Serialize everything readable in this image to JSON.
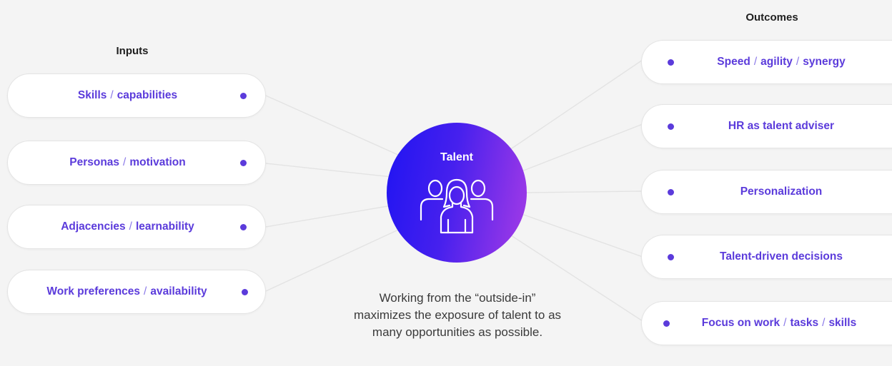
{
  "inputs": {
    "heading": "Inputs",
    "items": [
      {
        "parts": [
          "Skills",
          "capabilities"
        ]
      },
      {
        "parts": [
          "Personas",
          "motivation"
        ]
      },
      {
        "parts": [
          "Adjacencies",
          "learnability"
        ]
      },
      {
        "parts": [
          "Work preferences",
          "availability"
        ]
      }
    ]
  },
  "outcomes": {
    "heading": "Outcomes",
    "items": [
      {
        "parts": [
          "Speed",
          "agility",
          "synergy"
        ]
      },
      {
        "parts": [
          "HR as talent adviser"
        ]
      },
      {
        "parts": [
          "Personalization"
        ]
      },
      {
        "parts": [
          "Talent-driven decisions"
        ]
      },
      {
        "parts": [
          "Focus on work",
          "tasks",
          "skills"
        ]
      }
    ]
  },
  "hub": {
    "title": "Talent",
    "icon": "people-group-icon"
  },
  "note": "Working from the “outside-in” maximizes the exposure of talent to as many opportunities as possible.",
  "colors": {
    "accent": "#5b3bdb",
    "hub_start": "#1f14f2",
    "hub_end": "#a43be6",
    "line": "#e2e2e2"
  }
}
